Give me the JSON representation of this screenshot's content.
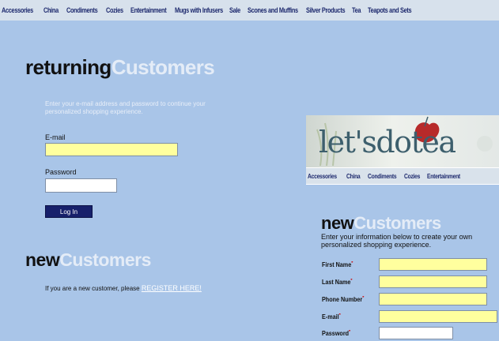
{
  "top_nav": [
    "Accessories",
    "China",
    "Condiments",
    "Cozies",
    "Entertainment",
    "Mugs with Infusers",
    "Sale",
    "Scones and Muffins",
    "Silver Products",
    "Tea",
    "Teapots and Sets"
  ],
  "returning": {
    "title_part1": "returning",
    "title_part2": "Customers",
    "description": "Enter your e-mail address and password to continue your personalized shopping experience.",
    "email_label": "E-mail",
    "email_value": "",
    "password_label": "Password",
    "password_value": "",
    "login_button": "Log In"
  },
  "new_customers": {
    "title_part1": "new",
    "title_part2": "Customers",
    "prompt": "If you are a new customer, please ",
    "register_link": "REGISTER HERE!"
  },
  "overlay": {
    "logo_text": "let'sdotea",
    "nav": [
      "Accessories",
      "China",
      "Condiments",
      "Cozies",
      "Entertainment"
    ],
    "title_part1": "new",
    "title_part2": "Customers",
    "description": "Enter your information below to create your own personalized shopping experience.",
    "fields": [
      {
        "label": "First Name",
        "value": "",
        "style": "yellow"
      },
      {
        "label": "Last Name",
        "value": "",
        "style": "yellow"
      },
      {
        "label": "Phone Number",
        "value": "",
        "style": "yellow"
      },
      {
        "label": "E-mail",
        "value": "",
        "style": "yellow"
      },
      {
        "label": "Password",
        "value": "",
        "style": "white"
      }
    ],
    "required_marker": "*"
  },
  "colors": {
    "panel_blue": "#a9c5e8",
    "nav_text": "#1e2a6e",
    "input_yellow": "#ffff9e",
    "button_navy": "#17206b"
  }
}
